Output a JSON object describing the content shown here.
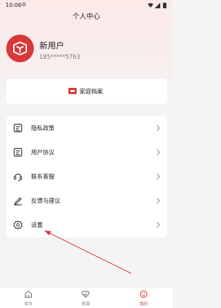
{
  "status_bar": {
    "time": "10:06"
  },
  "header": {
    "title": "个人中心"
  },
  "profile": {
    "name": "新用户",
    "phone": "185*****5763"
  },
  "family_card": {
    "label": "家庭档案"
  },
  "menu": [
    {
      "label": "隐私政策",
      "icon": "document-icon"
    },
    {
      "label": "用户协议",
      "icon": "document-icon"
    },
    {
      "label": "联系客服",
      "icon": "headset-icon"
    },
    {
      "label": "反馈与建议",
      "icon": "pen-icon"
    },
    {
      "label": "设置",
      "icon": "gear-icon"
    }
  ],
  "bottom_nav": [
    {
      "label": "首页",
      "icon": "home-icon",
      "active": false
    },
    {
      "label": "微课",
      "icon": "heart-check-icon",
      "active": false
    },
    {
      "label": "我的",
      "icon": "smile-icon",
      "active": true
    }
  ],
  "colors": {
    "accent": "#d9383a",
    "annotation_arrow": "#d9383a"
  }
}
